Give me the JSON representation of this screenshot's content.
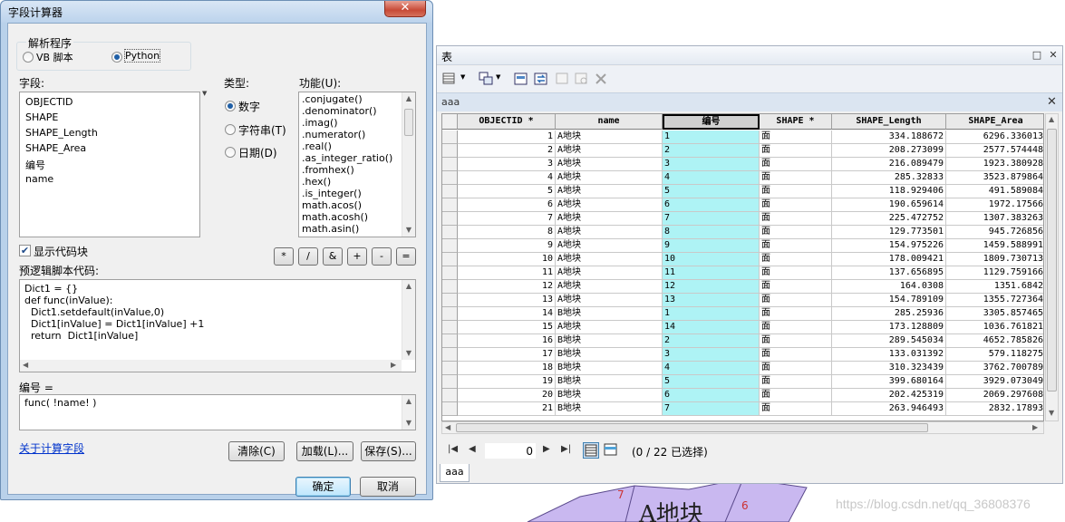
{
  "map": {
    "polygon_label": "A地块",
    "numbers": [
      "7",
      "6"
    ],
    "watermark": "https://blog.csdn.net/qq_36808376"
  },
  "field_calculator": {
    "title": "字段计算器",
    "close_glyph": "✕",
    "parser": {
      "group_label": "解析程序",
      "options": [
        {
          "label": "VB 脚本",
          "selected": false
        },
        {
          "label": "Python",
          "selected": true
        }
      ]
    },
    "fields": {
      "label": "字段:",
      "items": [
        "OBJECTID",
        "SHAPE",
        "SHAPE_Length",
        "SHAPE_Area",
        "编号",
        "name"
      ]
    },
    "type": {
      "label": "类型:",
      "options": [
        {
          "label": "数字",
          "selected": true
        },
        {
          "label": "字符串(T)",
          "selected": false
        },
        {
          "label": "日期(D)",
          "selected": false
        }
      ]
    },
    "functions": {
      "label": "功能(U):",
      "items": [
        ".conjugate()",
        ".denominator()",
        ".imag()",
        ".numerator()",
        ".real()",
        ".as_integer_ratio()",
        ".fromhex()",
        ".hex()",
        ".is_integer()",
        "math.acos()",
        "math.acosh()",
        "math.asin()"
      ]
    },
    "operators": [
      "*",
      "/",
      "&",
      "+",
      "-",
      "="
    ],
    "show_codeblock": {
      "label": "显示代码块",
      "checked": true
    },
    "prelogic": {
      "label": "预逻辑脚本代码:",
      "lines": [
        "Dict1 = {}",
        "def func(inValue):",
        "  Dict1.setdefault(inValue,0)",
        "  Dict1[inValue] = Dict1[inValue] +1",
        "  return  Dict1[inValue]"
      ]
    },
    "expression": {
      "label": "编号 =",
      "value": "func( !name! )"
    },
    "about_link": "关于计算字段",
    "buttons": {
      "clear": "清除(C)",
      "load": "加载(L)...",
      "save": "保存(S)...",
      "ok": "确定",
      "cancel": "取消"
    }
  },
  "table_window": {
    "title": "表",
    "controls": {
      "dock": "□",
      "close": "✕"
    },
    "toolbar_icons": [
      "table-options-icon",
      "related-tables-icon",
      "select-by-attributes-icon",
      "switch-selection-icon",
      "clear-selection-icon",
      "zoom-to-selected-icon",
      "delete-selected-icon"
    ],
    "tab_label": "aaa",
    "tab_close": "✕",
    "columns": [
      "OBJECTID *",
      "name",
      "编号",
      "SHAPE *",
      "SHAPE_Length",
      "SHAPE_Area"
    ],
    "selected_column": "编号",
    "rows": [
      [
        "1",
        "A地块",
        "1",
        "面",
        "334.188672",
        "6296.336013"
      ],
      [
        "2",
        "A地块",
        "2",
        "面",
        "208.273099",
        "2577.574448"
      ],
      [
        "3",
        "A地块",
        "3",
        "面",
        "216.089479",
        "1923.380928"
      ],
      [
        "4",
        "A地块",
        "4",
        "面",
        "285.32833",
        "3523.879864"
      ],
      [
        "5",
        "A地块",
        "5",
        "面",
        "118.929406",
        "491.589084"
      ],
      [
        "6",
        "A地块",
        "6",
        "面",
        "190.659614",
        "1972.17566"
      ],
      [
        "7",
        "A地块",
        "7",
        "面",
        "225.472752",
        "1307.383263"
      ],
      [
        "8",
        "A地块",
        "8",
        "面",
        "129.773501",
        "945.726856"
      ],
      [
        "9",
        "A地块",
        "9",
        "面",
        "154.975226",
        "1459.588991"
      ],
      [
        "10",
        "A地块",
        "10",
        "面",
        "178.009421",
        "1809.730713"
      ],
      [
        "11",
        "A地块",
        "11",
        "面",
        "137.656895",
        "1129.759166"
      ],
      [
        "12",
        "A地块",
        "12",
        "面",
        "164.0308",
        "1351.6842"
      ],
      [
        "13",
        "A地块",
        "13",
        "面",
        "154.789109",
        "1355.727364"
      ],
      [
        "14",
        "B地块",
        "1",
        "面",
        "285.25936",
        "3305.857465"
      ],
      [
        "15",
        "A地块",
        "14",
        "面",
        "173.128809",
        "1036.761821"
      ],
      [
        "16",
        "B地块",
        "2",
        "面",
        "289.545034",
        "4652.785826"
      ],
      [
        "17",
        "B地块",
        "3",
        "面",
        "133.031392",
        "579.118275"
      ],
      [
        "18",
        "B地块",
        "4",
        "面",
        "310.323439",
        "3762.700789"
      ],
      [
        "19",
        "B地块",
        "5",
        "面",
        "399.680164",
        "3929.073049"
      ],
      [
        "20",
        "B地块",
        "6",
        "面",
        "202.425319",
        "2069.297608"
      ],
      [
        "21",
        "B地块",
        "7",
        "面",
        "263.946493",
        "2832.17893"
      ]
    ],
    "nav": {
      "current_record": "0",
      "selection_status": "(0 / 22 已选择)"
    },
    "bottom_tab": "aaa"
  }
}
